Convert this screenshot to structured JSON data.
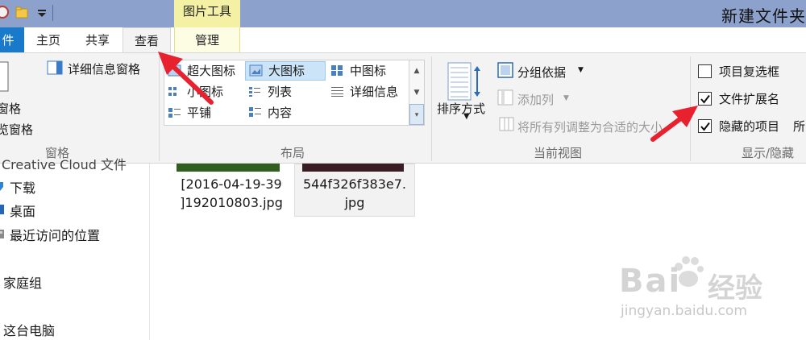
{
  "title_bar": {
    "context_tab": "图片工具",
    "window_title": "新建文件夹"
  },
  "tabs": [
    {
      "label": "件"
    },
    {
      "label": "主页"
    },
    {
      "label": "共享"
    },
    {
      "label": "查看"
    },
    {
      "label": "管理"
    }
  ],
  "ribbon": {
    "panes": {
      "details_pane": "详细信息窗格",
      "nav_pane_partial": "窗格",
      "preview_pane_partial": "览窗格",
      "group_label": "窗格"
    },
    "layout": {
      "items": [
        {
          "label": "超大图标"
        },
        {
          "label": "大图标"
        },
        {
          "label": "中图标"
        },
        {
          "label": "小图标"
        },
        {
          "label": "列表"
        },
        {
          "label": "详细信息"
        },
        {
          "label": "平铺"
        },
        {
          "label": "内容"
        }
      ],
      "group_label": "布局"
    },
    "current_view": {
      "sort_by": "排序方式",
      "group_by": "分组依据",
      "add_column": "添加列",
      "fit_columns": "将所有列调整为合适的大小",
      "group_label": "当前视图"
    },
    "show_hide": {
      "item_checkboxes": {
        "label": "项目复选框",
        "checked": false
      },
      "file_extensions": {
        "label": "文件扩展名",
        "checked": true
      },
      "hidden_items": {
        "label": "隐藏的项目",
        "checked": true
      },
      "hidden_items_extra": "所",
      "group_label": "显示/隐藏"
    }
  },
  "nav": {
    "items": [
      {
        "label": "Creative Cloud 文件"
      },
      {
        "label": "下载"
      },
      {
        "label": "桌面"
      },
      {
        "label": "最近访问的位置"
      },
      {
        "label": "家庭组"
      },
      {
        "label": "这台电脑"
      }
    ]
  },
  "files": [
    {
      "name_line1": "[2016-04-19-39",
      "name_line2": "]192010803.jpg"
    },
    {
      "name_line1": "544f326f383e7.",
      "name_line2": "jpg"
    }
  ],
  "watermark": {
    "brand": "Bai",
    "brand2": "经验",
    "url": "jingyan.baidu.com"
  },
  "colors": {
    "title_bar": "#8ca2cc",
    "context_tab": "#f4f1a4",
    "file_tab": "#1979ca",
    "ribbon_bg": "#f3f3f3",
    "selection": "#cce4f7",
    "annotation_arrow": "#e8212e"
  }
}
